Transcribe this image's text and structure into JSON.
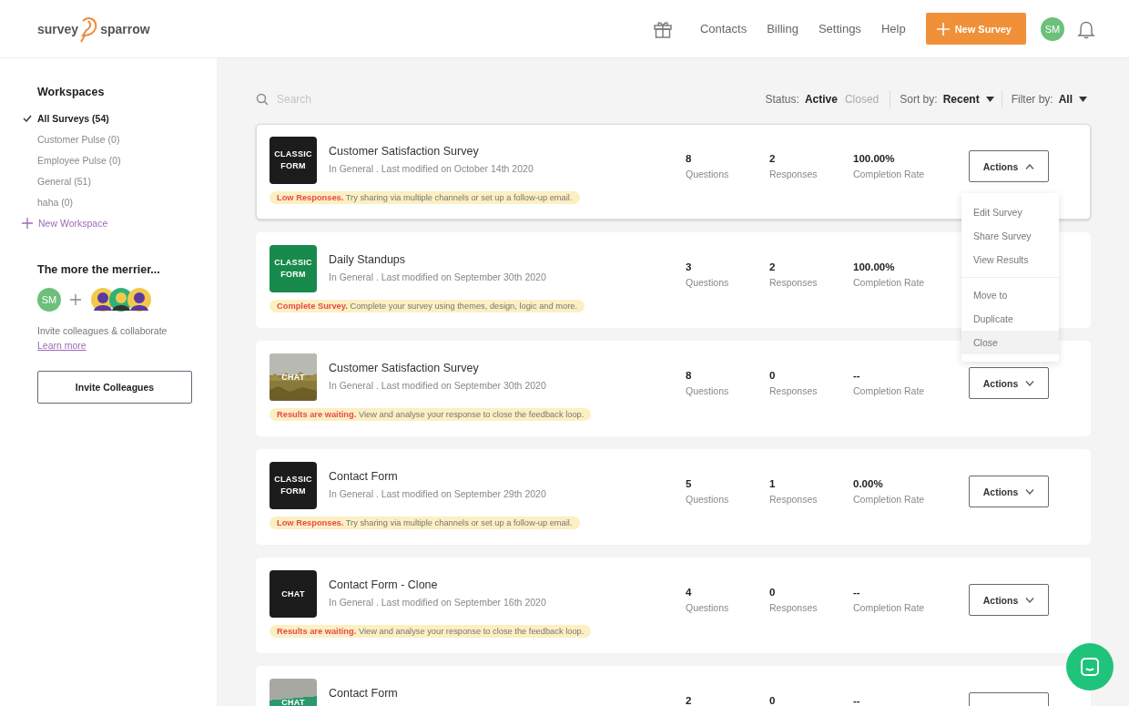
{
  "header": {
    "logo_left": "survey",
    "logo_right": "sparrow",
    "nav": [
      "Contacts",
      "Billing",
      "Settings",
      "Help"
    ],
    "new_button": "New Survey",
    "avatar": "SM"
  },
  "sidebar": {
    "title": "Workspaces",
    "items": [
      {
        "label": "All Surveys (54)",
        "selected": true
      },
      {
        "label": "Customer Pulse (0)",
        "selected": false
      },
      {
        "label": "Employee Pulse (0)",
        "selected": false
      },
      {
        "label": "General (51)",
        "selected": false
      },
      {
        "label": "haha (0)",
        "selected": false
      }
    ],
    "new_workspace": "New Workspace",
    "promo_title": "The more the merrier...",
    "promo_avatar": "SM",
    "promo_text": "Invite colleagues & collaborate",
    "learn_more": "Learn more",
    "invite_button": "Invite Colleagues"
  },
  "toolbar": {
    "search_placeholder": "Search",
    "status_label": "Status:",
    "statuses": [
      {
        "label": "Active",
        "selected": true
      },
      {
        "label": "Closed",
        "selected": false
      }
    ],
    "sort_label": "Sort by:",
    "sort_value": "Recent",
    "filter_label": "Filter by:",
    "filter_value": "All"
  },
  "surveys": [
    {
      "thumb": {
        "kind": "classic",
        "label": "CLASSIC FORM",
        "color": "#1c1c1c"
      },
      "title": "Customer Satisfaction Survey",
      "subtitle": "In General . Last modified on October 14th 2020",
      "notice": "**Low Responses.** Try sharing via multiple channels or set up a follow-up email.",
      "stats": [
        {
          "value": "8",
          "label": "Questions"
        },
        {
          "value": "2",
          "label": "Responses"
        },
        {
          "value": "100.00%",
          "label": "Completion Rate"
        }
      ],
      "actions": "Actions",
      "expanded": true,
      "focused": true
    },
    {
      "thumb": {
        "kind": "classic",
        "label": "CLASSIC FORM",
        "color": "#178a4c"
      },
      "title": "Daily Standups",
      "subtitle": "In General . Last modified on September 30th 2020",
      "notice": "**Complete Survey.** Complete your survey using themes, design, logic and more.",
      "stats": [
        {
          "value": "3",
          "label": "Questions"
        },
        {
          "value": "2",
          "label": "Responses"
        },
        {
          "value": "100.00%",
          "label": "Completion Rate"
        }
      ],
      "expanded": false,
      "focused": false
    },
    {
      "thumb": {
        "kind": "picture",
        "label": "CHAT",
        "color": "#8a7a3a"
      },
      "title": "Customer Satisfaction Survey",
      "subtitle": "In General . Last modified on September 30th 2020",
      "notice": "**Results are waiting.** View and analyse your response to close the feedback loop.",
      "stats": [
        {
          "value": "8",
          "label": "Questions"
        },
        {
          "value": "0",
          "label": "Responses"
        },
        {
          "value": "--",
          "label": "Completion Rate"
        }
      ],
      "actions": "Actions",
      "expanded": false,
      "focused": false
    },
    {
      "thumb": {
        "kind": "classic",
        "label": "CLASSIC FORM",
        "color": "#1c1c1c"
      },
      "title": "Contact Form",
      "subtitle": "In General . Last modified on September 29th 2020",
      "notice": "**Low Responses.** Try sharing via multiple channels or set up a follow-up email.",
      "stats": [
        {
          "value": "5",
          "label": "Questions"
        },
        {
          "value": "1",
          "label": "Responses"
        },
        {
          "value": "0.00%",
          "label": "Completion Rate"
        }
      ],
      "actions": "Actions",
      "expanded": false,
      "focused": false
    },
    {
      "thumb": {
        "kind": "chat",
        "label": "CHAT",
        "color": "#1c1c1c"
      },
      "title": "Contact Form - Clone",
      "subtitle": "In General . Last modified on September 16th 2020",
      "notice": "**Results are waiting.** View and analyse your response to close the feedback loop.",
      "stats": [
        {
          "value": "4",
          "label": "Questions"
        },
        {
          "value": "0",
          "label": "Responses"
        },
        {
          "value": "--",
          "label": "Completion Rate"
        }
      ],
      "actions": "Actions",
      "expanded": false,
      "focused": false
    },
    {
      "thumb": {
        "kind": "banded",
        "label": "CHAT",
        "color": "#2a9a6a"
      },
      "title": "Contact Form",
      "stats": [
        {
          "value": "2"
        },
        {
          "value": "0"
        },
        {
          "value": "--"
        }
      ],
      "expanded": false,
      "focused": false
    }
  ],
  "actions_menu": {
    "groups": [
      [
        {
          "label": "Edit Survey",
          "highlighted": false
        },
        {
          "label": "Share Survey",
          "highlighted": false
        },
        {
          "label": "View Results",
          "highlighted": false
        }
      ],
      [
        {
          "label": "Move to",
          "highlighted": false
        },
        {
          "label": "Duplicate",
          "highlighted": false
        },
        {
          "label": "Close",
          "highlighted": true
        }
      ]
    ]
  }
}
